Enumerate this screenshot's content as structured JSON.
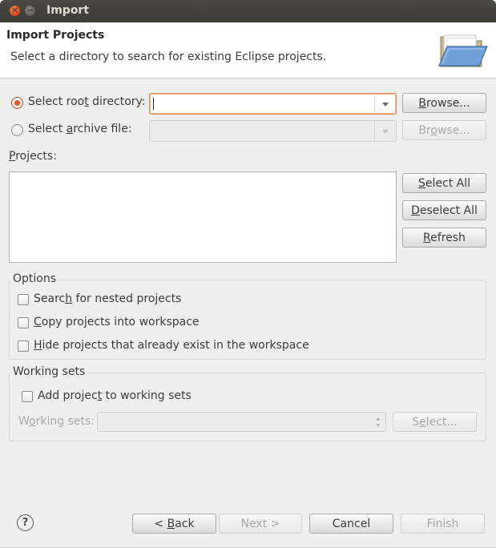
{
  "window": {
    "title": "Import",
    "close_glyph": "×",
    "min_glyph": "−"
  },
  "header": {
    "title": "Import Projects",
    "description": "Select a directory to search for existing Eclipse projects."
  },
  "source": {
    "root_dir": {
      "label_pre": "Select roo",
      "label_ul": "t",
      "label_post": " directory:",
      "value": "",
      "browse": {
        "pre": "",
        "ul": "B",
        "post": "rowse..."
      }
    },
    "archive": {
      "label_pre": "Select ",
      "label_ul": "a",
      "label_post": "rchive file:",
      "value": "",
      "browse": {
        "pre": "Br",
        "ul": "o",
        "post": "wse..."
      }
    }
  },
  "projects": {
    "label_ul": "P",
    "label_post": "rojects:",
    "items": [],
    "select_all": {
      "ul": "S",
      "post": "elect All"
    },
    "deselect_all": {
      "ul": "D",
      "post": "eselect All"
    },
    "refresh": {
      "ul": "R",
      "post": "efresh"
    }
  },
  "options": {
    "title": "Options",
    "nested": {
      "pre": "Searc",
      "ul": "h",
      "post": " for nested projects"
    },
    "copy": {
      "pre": "",
      "ul": "C",
      "post": "opy projects into workspace"
    },
    "hide": {
      "pre": "",
      "ul": "H",
      "post": "ide projects that already exist in the workspace"
    }
  },
  "working_sets": {
    "title": "Working sets",
    "add": {
      "pre": "Add projec",
      "ul": "t",
      "post": " to working sets"
    },
    "sets_label": {
      "pre": "W",
      "ul": "o",
      "post": "rking sets:"
    },
    "sets_value": "",
    "select": {
      "pre": "S",
      "ul": "e",
      "post": "lect..."
    }
  },
  "footer": {
    "help_glyph": "?",
    "back": {
      "pre": "< ",
      "ul": "B",
      "post": "ack"
    },
    "next": {
      "pre": "",
      "ul": "",
      "post": "Next >"
    },
    "cancel": "Cancel",
    "finish": "Finish"
  }
}
